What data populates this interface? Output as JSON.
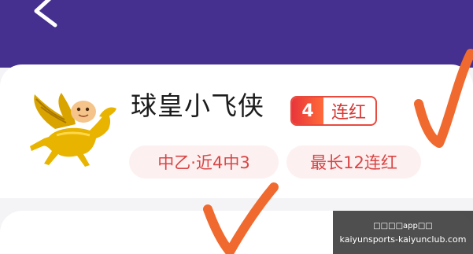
{
  "colors": {
    "header_bg": "#452f8f",
    "badge_red": "#e84a3e",
    "tag_bg": "#fdf0f0",
    "tag_text": "#d94545",
    "check_orange": "#f06a2f"
  },
  "header": {
    "back_icon": "chevron-left-icon"
  },
  "profile": {
    "avatar_icon": "winged-horse-icon",
    "name": "球皇小飞侠",
    "streak": {
      "count": "4",
      "label": "连红"
    },
    "tags": [
      {
        "text": "中乙·近4中3"
      },
      {
        "text": "最长12连红"
      }
    ]
  },
  "overlay": {
    "marks": [
      "checkmark-icon",
      "checkmark-icon"
    ]
  },
  "watermark": {
    "line1": "□□□□app□□",
    "line2": "kaiyunsports-kaiyunclub.com"
  }
}
